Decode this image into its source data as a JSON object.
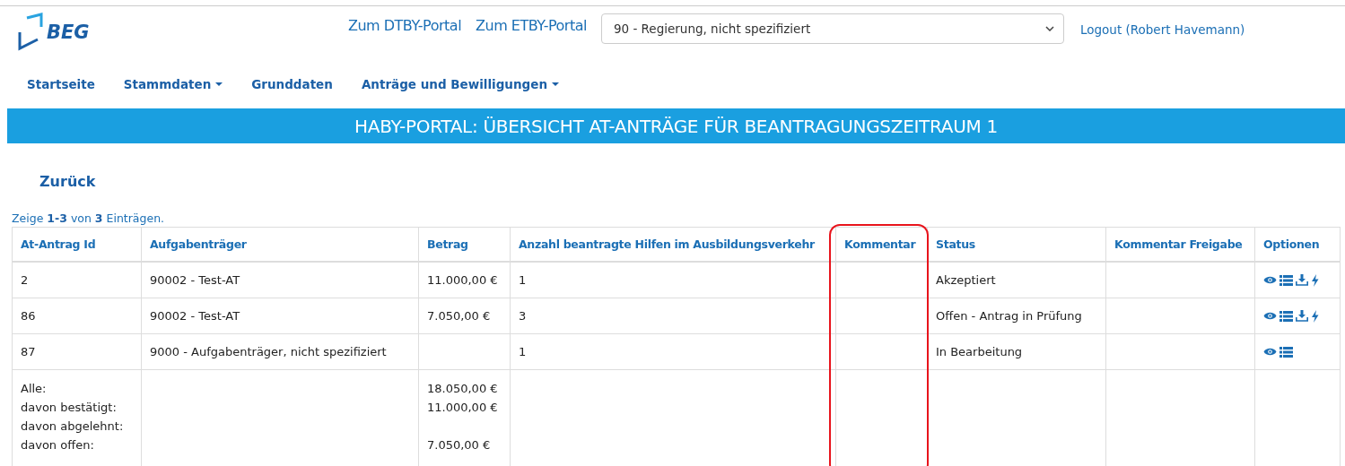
{
  "logo": {
    "text": "BEG"
  },
  "top_links": [
    "Zum DTBY-Portal",
    "Zum ETBY-Portal"
  ],
  "org_select": {
    "value": "90 - Regierung, nicht spezifiziert"
  },
  "logout": "Logout (Robert Havemann)",
  "nav": [
    {
      "label": "Startseite",
      "dropdown": false
    },
    {
      "label": "Stammdaten",
      "dropdown": true
    },
    {
      "label": "Grunddaten",
      "dropdown": false
    },
    {
      "label": "Anträge und Bewilligungen",
      "dropdown": true
    }
  ],
  "banner": "HABY-PORTAL: ÜBERSICHT AT-ANTRÄGE FÜR BEANTRAGUNGSZEITRAUM 1",
  "back_link": "Zurück",
  "entries_info": "Zeige **1-3** von **3** Einträgen.",
  "table": {
    "columns": [
      {
        "label": "At-Antrag Id",
        "highlighted": false
      },
      {
        "label": "Aufgabenträger",
        "highlighted": false
      },
      {
        "label": "Betrag",
        "highlighted": false
      },
      {
        "label": "Anzahl beantragte Hilfen im Ausbildungsverkehr",
        "highlighted": false
      },
      {
        "label": "Kommentar",
        "highlighted": true
      },
      {
        "label": "Status",
        "highlighted": false
      },
      {
        "label": "Kommentar Freigabe",
        "highlighted": false
      },
      {
        "label": "Optionen",
        "highlighted": false
      }
    ],
    "rows": [
      {
        "id": "2",
        "provider": "90002 - Test-AT",
        "amount": "11.000,00 €",
        "count": "1",
        "status": "Akzeptiert",
        "actions": [
          {
            "kind": "view"
          },
          {
            "kind": "list"
          },
          {
            "kind": "download"
          },
          {
            "kind": "flash"
          }
        ]
      },
      {
        "id": "86",
        "provider": "90002 - Test-AT",
        "amount": "7.050,00 €",
        "count": "3",
        "status": "Offen - Antrag in Prüfung",
        "actions": [
          {
            "kind": "view"
          },
          {
            "kind": "list"
          },
          {
            "kind": "download"
          },
          {
            "kind": "flash"
          }
        ]
      },
      {
        "id": "87",
        "provider": "9000 - Aufgabenträger, nicht spezifiziert",
        "count": "1",
        "status": "In Bearbeitung",
        "actions": [
          {
            "kind": "view"
          },
          {
            "kind": "list"
          }
        ]
      }
    ],
    "summary": [
      {
        "label": "Alle:",
        "amount": "18.050,00 €"
      },
      {
        "label": "davon bestätigt:",
        "amount": "11.000,00 €"
      },
      {
        "label": "davon abgelehnt:"
      },
      {
        "label": "davon offen:",
        "amount": "7.050,00 €"
      }
    ]
  }
}
